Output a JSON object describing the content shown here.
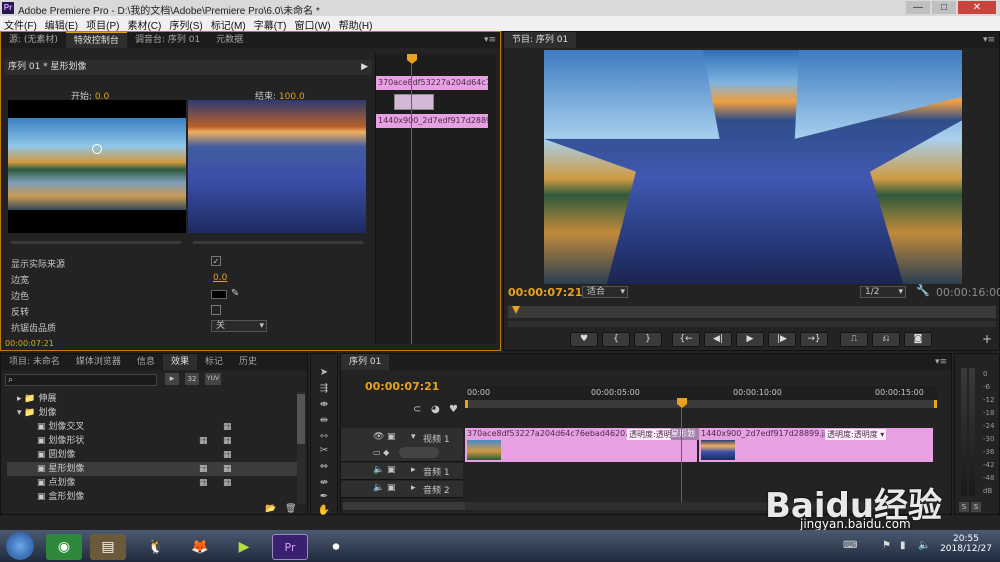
{
  "window": {
    "title": "Adobe Premiere Pro - D:\\我的文档\\Adobe\\Premiere Pro\\6.0\\未命名 *",
    "logo": "Pr",
    "min": "—",
    "max": "□",
    "close": "✕"
  },
  "menu": [
    "文件(F)",
    "编辑(E)",
    "项目(P)",
    "素材(C)",
    "序列(S)",
    "标记(M)",
    "字幕(T)",
    "窗口(W)",
    "帮助(H)"
  ],
  "effect_controls": {
    "tabs": [
      "源: (无素材)",
      "特效控制台",
      "调音台: 序列 01",
      "元数据"
    ],
    "active_tab": 1,
    "sequence": "序列 01 * 星形划像",
    "start_label": "开始:",
    "start_value": "0.0",
    "end_label": "结束:",
    "end_value": "100.0",
    "props": [
      {
        "label": "显示实际来源",
        "value": "✓"
      },
      {
        "label": "边宽",
        "value": "0.0"
      },
      {
        "label": "边色",
        "value": ""
      },
      {
        "label": "反转",
        "value": ""
      },
      {
        "label": "抗锯齿品质",
        "value": "关"
      }
    ],
    "timecode": "00:00:07:21",
    "clip_a": "370ace8df53227a204d64c76e",
    "clip_b": "1440x900_2d7edf917d28899"
  },
  "program": {
    "tab": "节目: 序列 01",
    "timecode": "00:00:07:21",
    "fit": "适合",
    "resolution": "1/2",
    "duration": "00:00:16:00"
  },
  "project": {
    "tabs": [
      "项目: 未命名",
      "媒体浏览器",
      "信息",
      "效果",
      "标记",
      "历史"
    ],
    "active_tab": 3,
    "search_placeholder": "",
    "tree": [
      {
        "label": "伸展",
        "level": 1,
        "type": "folder",
        "open": false
      },
      {
        "label": "划像",
        "level": 1,
        "type": "folder",
        "open": true
      },
      {
        "label": "划像交叉",
        "level": 2,
        "type": "item"
      },
      {
        "label": "划像形状",
        "level": 2,
        "type": "item"
      },
      {
        "label": "圆划像",
        "level": 2,
        "type": "item"
      },
      {
        "label": "星形划像",
        "level": 2,
        "type": "item"
      },
      {
        "label": "点划像",
        "level": 2,
        "type": "item"
      },
      {
        "label": "盒形划像",
        "level": 2,
        "type": "item"
      }
    ]
  },
  "timeline": {
    "tab": "序列 01",
    "timecode": "00:00:07:21",
    "ruler": [
      "00:00",
      "00:00:05:00",
      "00:00:10:00",
      "00:00:15:00"
    ],
    "tracks": [
      {
        "name": "视频 1",
        "kind": "video"
      },
      {
        "name": "音频 1",
        "kind": "audio"
      },
      {
        "name": "音频 2",
        "kind": "audio"
      }
    ],
    "clip1": "370ace8df53227a204d64c76ebad4620.jpg",
    "clip1_effect": "透明度:透明度 ▾",
    "transition": "星形划",
    "clip2": "1440x900_2d7edf917d28899.jpg",
    "clip2_effect": "透明度:透明度 ▾"
  },
  "meter_labels": [
    "0",
    "-6",
    "-12",
    "-18",
    "-24",
    "-30",
    "-36",
    "-42",
    "-48",
    "dB"
  ],
  "meter_buttons": [
    "S",
    "S"
  ],
  "watermark": {
    "brand": "Baidu经验",
    "url": "jingyan.baidu.com"
  },
  "taskbar": {
    "time": "20:55",
    "date": "2018/12/27"
  }
}
